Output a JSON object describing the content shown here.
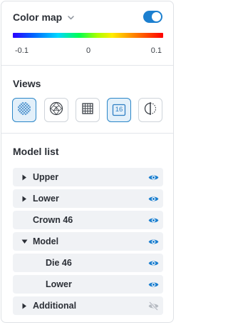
{
  "color_map": {
    "title": "Color map",
    "enabled": true,
    "scale": {
      "min_label": "-0.1",
      "mid_label": "0",
      "max_label": "0.1"
    }
  },
  "views": {
    "title": "Views",
    "buttons": [
      {
        "icon": "mesh-sphere-icon",
        "active": true
      },
      {
        "icon": "wireframe-sphere-icon",
        "active": false
      },
      {
        "icon": "grid-icon",
        "active": false
      },
      {
        "icon": "number-badge-icon",
        "label": "16",
        "active": true
      },
      {
        "icon": "half-circle-section-icon",
        "active": false
      }
    ]
  },
  "model_list": {
    "title": "Model list",
    "items": [
      {
        "label": "Upper",
        "expandable": true,
        "expanded": false,
        "visible": true
      },
      {
        "label": "Lower",
        "expandable": true,
        "expanded": false,
        "visible": true
      },
      {
        "label": "Crown 46",
        "expandable": false,
        "visible": true
      },
      {
        "label": "Model",
        "expandable": true,
        "expanded": true,
        "visible": true
      },
      {
        "label": "Die 46",
        "expandable": false,
        "indent": true,
        "visible": true
      },
      {
        "label": "Lower",
        "expandable": false,
        "indent": true,
        "visible": true
      },
      {
        "label": "Additional",
        "expandable": true,
        "expanded": false,
        "visible": false
      }
    ]
  },
  "colors": {
    "accent": "#1c7fcf",
    "row_bg": "#f0f2f5",
    "active_bg": "#e3f0fa",
    "hidden_icon": "#b4b9c0"
  }
}
